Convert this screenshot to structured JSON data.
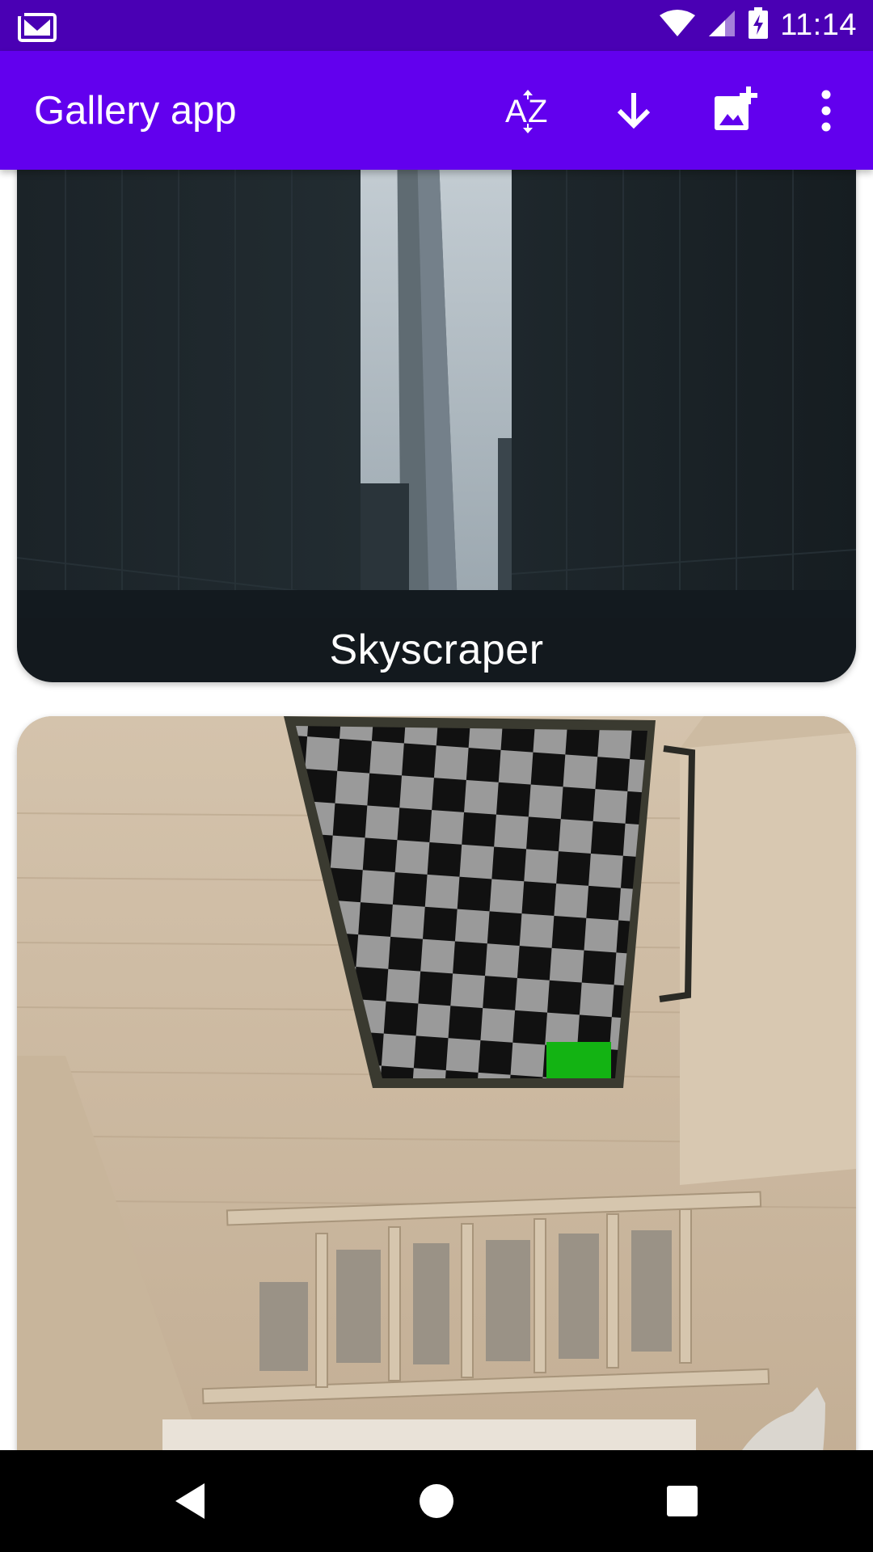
{
  "status_bar": {
    "time": "11:14",
    "icons": [
      "gmail-icon",
      "wifi-icon",
      "signal-icon",
      "battery-charging-icon"
    ]
  },
  "app_bar": {
    "title": "Gallery app",
    "actions": [
      "sort-az-icon",
      "download-icon",
      "add-photo-icon",
      "more-vert-icon"
    ]
  },
  "gallery": {
    "items": [
      {
        "caption": "Skyscraper",
        "image": "skyscraper-photo"
      },
      {
        "caption": "",
        "image": "room-with-checkerboard-photo"
      }
    ]
  },
  "nav_bar": {
    "buttons": [
      "back-icon",
      "home-icon",
      "recents-icon"
    ]
  },
  "colors": {
    "status_bar": "#4a00b4",
    "app_bar": "#6200ee",
    "accent_green": "#13b313"
  }
}
